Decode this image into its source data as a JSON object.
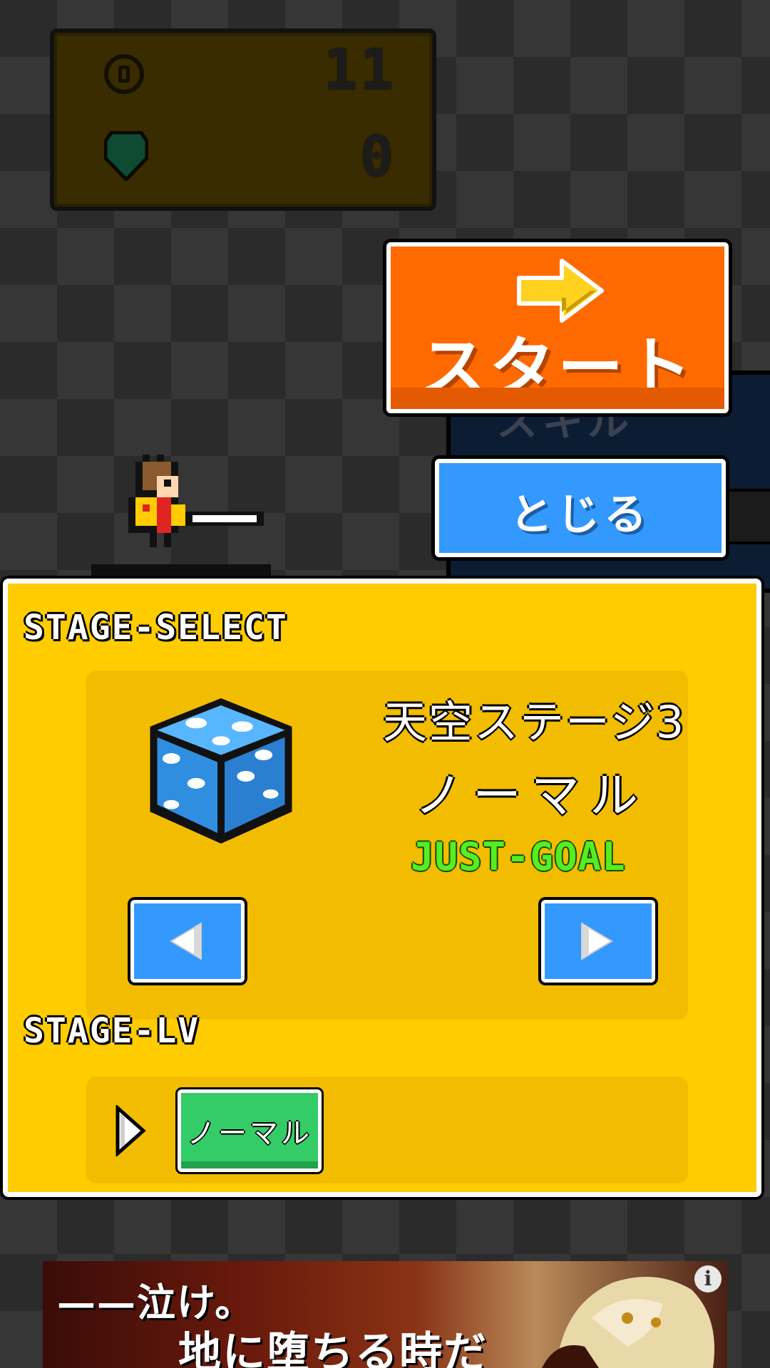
{
  "currency": {
    "coins": "11",
    "gems": "0"
  },
  "buttons": {
    "start": "スタート",
    "skill": "スキル",
    "close": "とじる"
  },
  "stage_select": {
    "title": "STAGE-SELECT",
    "stage_name": "天空ステージ3",
    "difficulty": "ノーマル",
    "mode": "JUST-GOAL",
    "level_title": "STAGE-LV",
    "level_option": "ノーマル"
  },
  "ad": {
    "headline": "——泣け。",
    "subline": "地に堕ちる時だ",
    "info": "i"
  },
  "colors": {
    "start": "#ff6a00",
    "close": "#3399ff",
    "panel": "#ffcc00",
    "level": "#33cc66",
    "mode_text": "#55ee22"
  },
  "icons": {
    "coin": "coin-icon",
    "gem": "gem-icon",
    "start_arrow": "arrow-right-icon",
    "dice": "cloud-dice-icon",
    "prev": "triangle-left-icon",
    "next": "triangle-right-icon",
    "pointer": "triangle-right-icon"
  }
}
